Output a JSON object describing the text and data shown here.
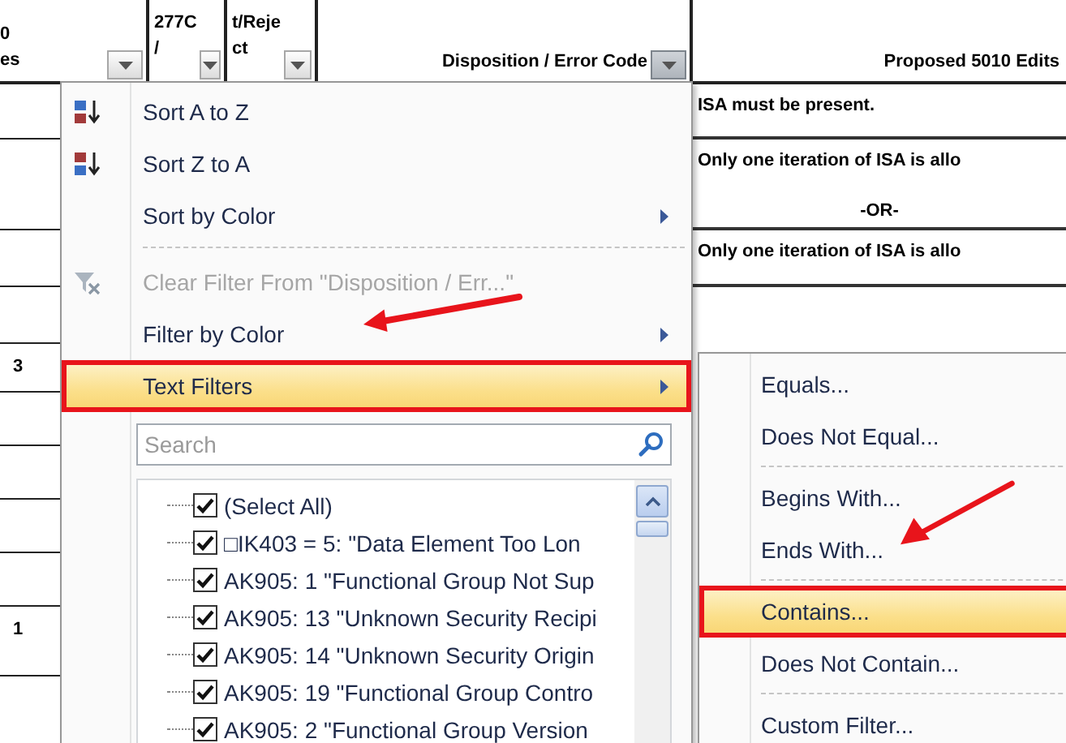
{
  "sheet": {
    "columns": [
      {
        "header": [
          "0",
          "es"
        ],
        "filter_open": false
      },
      {
        "header": [
          "277C",
          "/"
        ],
        "filter_open": false
      },
      {
        "header": [
          "t/Reje",
          "ct"
        ],
        "filter_open": false
      },
      {
        "header": [
          "Disposition / Error Code"
        ],
        "filter_open": true
      },
      {
        "header": [
          "Proposed 5010 Edits"
        ]
      }
    ],
    "rows": [
      {
        "proposed_5010_edits": [
          "ISA must be present."
        ]
      },
      {
        "proposed_5010_edits": [
          "Only one iteration of ISA is allo",
          "-OR-"
        ]
      },
      {
        "proposed_5010_edits": [
          "Only one iteration of ISA is allo"
        ]
      },
      {},
      {
        "column_1": "3"
      },
      {},
      {},
      {},
      {},
      {
        "column_1": "1"
      }
    ]
  },
  "filter_menu": {
    "items": [
      {
        "kind": "ascending",
        "label": "Sort A to Z",
        "disabled": false,
        "submenu": false,
        "highlighted": false
      },
      {
        "kind": "descending",
        "label": "Sort Z to A",
        "disabled": false,
        "submenu": false,
        "highlighted": false
      },
      {
        "kind": "command",
        "label": "Sort by Color",
        "disabled": false,
        "submenu": true,
        "highlighted": false
      },
      {
        "kind": "separator"
      },
      {
        "kind": "unfilter",
        "label": "Clear Filter From \"Disposition / Err...\"",
        "disabled": true,
        "submenu": false,
        "highlighted": false
      },
      {
        "kind": "command",
        "label": "Filter by Color",
        "disabled": false,
        "submenu": true,
        "highlighted": false,
        "callout_arrow": true
      },
      {
        "kind": "command",
        "label": "Text Filters",
        "disabled": false,
        "submenu": true,
        "highlighted": true
      }
    ],
    "search": {
      "placeholder": "Search"
    },
    "values": [
      {
        "label": "(Select All)",
        "checked": true
      },
      {
        "label": "□IK403 = 5: \"Data Element Too Lon",
        "checked": true
      },
      {
        "label": "AK905: 1 \"Functional Group Not Sup",
        "checked": true
      },
      {
        "label": "AK905: 13 \"Unknown Security Recipi",
        "checked": true
      },
      {
        "label": "AK905: 14 \"Unknown Security Origin",
        "checked": true
      },
      {
        "label": "AK905: 19 \"Functional Group Contro",
        "checked": true
      },
      {
        "label": "AK905: 2 \"Functional Group Version",
        "checked": true
      }
    ]
  },
  "text_filters_menu": {
    "items": [
      {
        "kind": "command",
        "label": "Equals...",
        "highlighted": false
      },
      {
        "kind": "command",
        "label": "Does Not Equal...",
        "highlighted": false
      },
      {
        "kind": "separator"
      },
      {
        "kind": "command",
        "label": "Begins With...",
        "highlighted": false
      },
      {
        "kind": "command",
        "label": "Ends With...",
        "highlighted": false,
        "callout_arrow": true
      },
      {
        "kind": "separator"
      },
      {
        "kind": "command",
        "label": "Contains...",
        "highlighted": true
      },
      {
        "kind": "command",
        "label": "Does Not Contain...",
        "highlighted": false
      },
      {
        "kind": "separator"
      },
      {
        "kind": "command",
        "label": "Custom Filter...",
        "highlighted": false
      }
    ]
  }
}
